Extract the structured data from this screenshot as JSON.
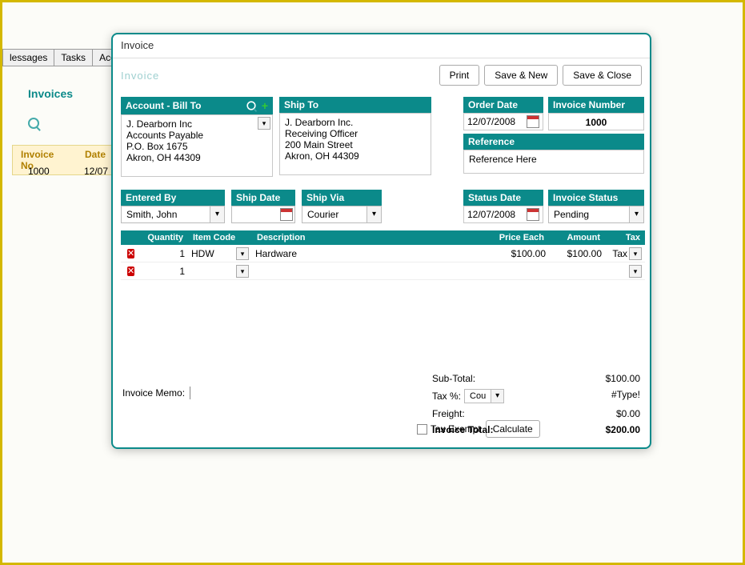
{
  "bg": {
    "tabs": [
      "lessages",
      "Tasks",
      "Accounts"
    ],
    "page_title": "Invoices",
    "list_headers": [
      "Invoice No",
      "Date"
    ],
    "list_row": {
      "no": "1000",
      "date": "12/07"
    }
  },
  "dialog": {
    "title": "Invoice",
    "crumb": "Invoice",
    "buttons": {
      "print": "Print",
      "save_new": "Save & New",
      "save_close": "Save & Close"
    }
  },
  "billto": {
    "header": "Account - Bill To",
    "lines": [
      "J. Dearborn Inc",
      "Accounts Payable",
      "P.O. Box 1675",
      "Akron, OH  44309"
    ]
  },
  "shipto": {
    "header": "Ship To",
    "lines": [
      "J. Dearborn Inc.",
      "Receiving Officer",
      "200 Main Street",
      "Akron, OH  44309"
    ]
  },
  "order_date": {
    "header": "Order Date",
    "value": "12/07/2008"
  },
  "invoice_no": {
    "header": "Invoice Number",
    "value": "1000"
  },
  "reference": {
    "header": "Reference",
    "value": "Reference Here"
  },
  "entered_by": {
    "header": "Entered By",
    "value": "Smith, John"
  },
  "ship_date": {
    "header": "Ship Date",
    "value": ""
  },
  "ship_via": {
    "header": "Ship Via",
    "value": "Courier"
  },
  "status_date": {
    "header": "Status Date",
    "value": "12/07/2008"
  },
  "invoice_status": {
    "header": "Invoice Status",
    "value": "Pending"
  },
  "grid": {
    "headers": {
      "qty": "Quantity",
      "code": "Item Code",
      "desc": "Description",
      "price": "Price Each",
      "amount": "Amount",
      "tax": "Tax"
    },
    "rows": [
      {
        "qty": "1",
        "code": "HDW",
        "desc": "Hardware",
        "price": "$100.00",
        "amount": "$100.00",
        "tax": "Tax"
      },
      {
        "qty": "1",
        "code": "",
        "desc": "",
        "price": "",
        "amount": "",
        "tax": ""
      }
    ]
  },
  "memo": {
    "label": "Invoice Memo:",
    "value": ""
  },
  "tax_exempt_label": "Tax Exempt",
  "calculate_label": "Calculate",
  "totals": {
    "subtotal_label": "Sub-Total:",
    "subtotal": "$100.00",
    "taxpct_label": "Tax %:",
    "taxpct_val": "Cou",
    "taxpct_amount": "#Type!",
    "freight_label": "Freight:",
    "freight": "$0.00",
    "total_label": "Invoice Total:",
    "total": "$200.00"
  }
}
